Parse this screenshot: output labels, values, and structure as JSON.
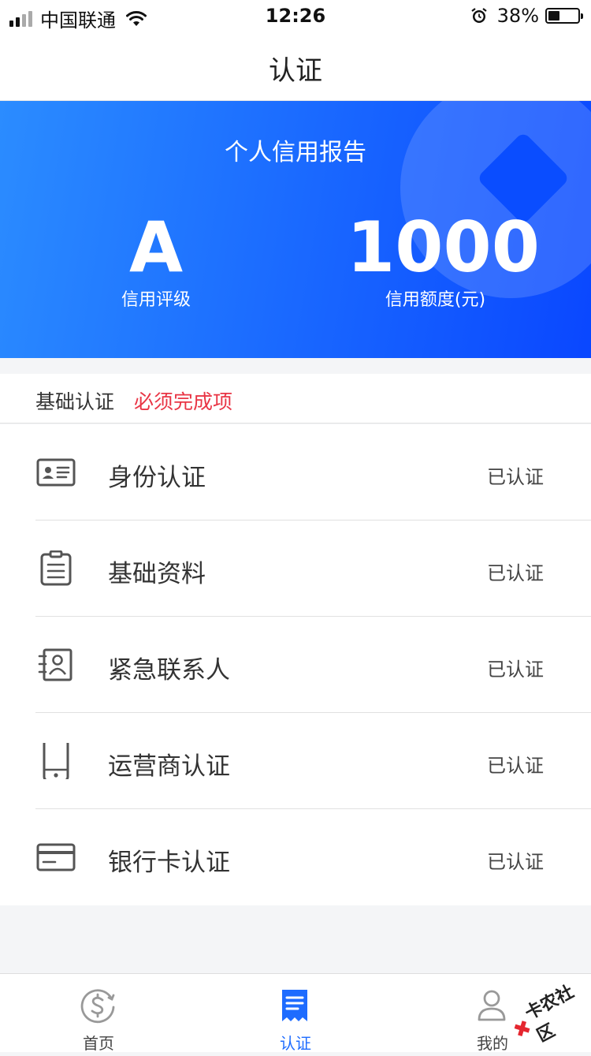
{
  "status_bar": {
    "carrier": "中国联通",
    "time": "12:26",
    "battery": "38%"
  },
  "nav": {
    "title": "认证"
  },
  "banner": {
    "title": "个人信用报告",
    "grade_value": "A",
    "grade_label": "信用评级",
    "limit_value": "1000",
    "limit_label": "信用额度(元)"
  },
  "section": {
    "title": "基础认证",
    "required": "必须完成项"
  },
  "items": [
    {
      "label": "身份认证",
      "status": "已认证",
      "icon": "id-card-icon"
    },
    {
      "label": "基础资料",
      "status": "已认证",
      "icon": "clipboard-icon"
    },
    {
      "label": "紧急联系人",
      "status": "已认证",
      "icon": "contact-book-icon"
    },
    {
      "label": "运营商认证",
      "status": "已认证",
      "icon": "mobile-phone-icon"
    },
    {
      "label": "银行卡认证",
      "status": "已认证",
      "icon": "bank-card-icon"
    }
  ],
  "tabs": [
    {
      "label": "首页",
      "icon": "dollar-circle-icon",
      "active": false
    },
    {
      "label": "认证",
      "icon": "document-icon",
      "active": true
    },
    {
      "label": "我的",
      "icon": "user-icon",
      "active": false
    }
  ],
  "colors": {
    "accent": "#1e6cff",
    "required": "#e93545",
    "banner_start": "#2b8cff",
    "banner_end": "#0a47ff"
  },
  "watermark": {
    "text": "卡农社区"
  }
}
